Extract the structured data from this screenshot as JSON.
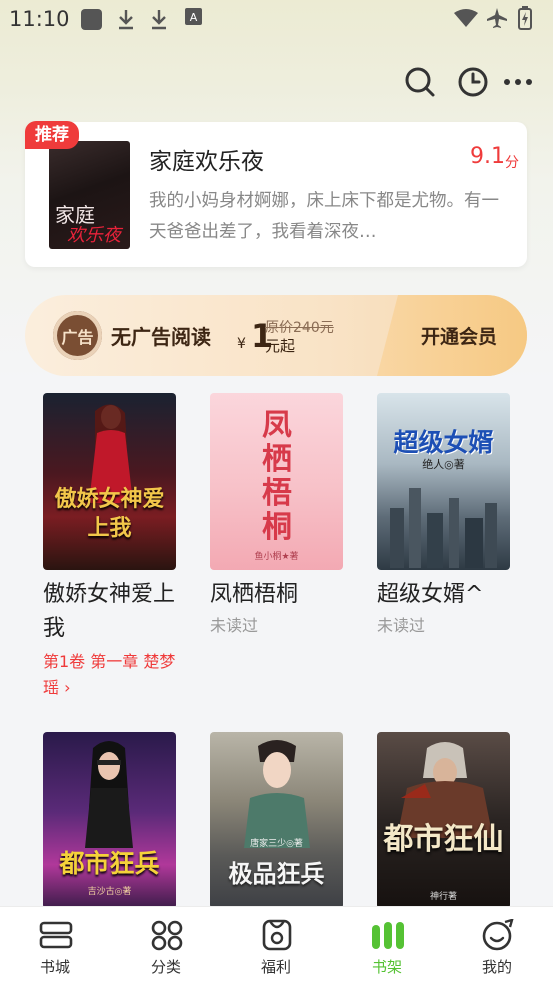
{
  "status_bar": {
    "time": "11:10"
  },
  "recommend": {
    "badge": "推荐",
    "cover_line1": "家庭",
    "cover_line2": "欢乐夜",
    "title": "家庭欢乐夜",
    "score": "9.1",
    "score_unit": "分",
    "description": "我的小妈身材婀娜，床上床下都是尤物。有一天爸爸出差了，我看着深夜…"
  },
  "vip_banner": {
    "icon_text": "广告",
    "label": "无广告阅读",
    "currency": "¥",
    "price": "1",
    "original_price": "原价240元",
    "price_suffix": "元起",
    "button": "开通会员"
  },
  "books": [
    {
      "title": "傲娇女神爱上我",
      "cover_title": "傲娇女神爱上我",
      "progress": "第1卷 第一章 楚梦瑶 ›"
    },
    {
      "title": "凤栖梧桐",
      "cover_title": "凤栖梧桐",
      "cover_author": "鱼小桐★著",
      "status": "未读过"
    },
    {
      "title": "超级女婿^",
      "cover_title": "超级女婿",
      "cover_author": "绝人◎著",
      "status": "未读过"
    },
    {
      "cover_title": "都市狂兵",
      "cover_author": "吉沙古◎著"
    },
    {
      "cover_title": "极品狂兵",
      "cover_author": "唐家三少◎著"
    },
    {
      "cover_title": "都市狂仙",
      "cover_author": "神行著"
    }
  ],
  "tabs": [
    {
      "label": "书城",
      "icon": "bookstore-icon"
    },
    {
      "label": "分类",
      "icon": "category-icon"
    },
    {
      "label": "福利",
      "icon": "welfare-icon"
    },
    {
      "label": "书架",
      "icon": "bookshelf-icon",
      "active": true
    },
    {
      "label": "我的",
      "icon": "profile-icon"
    }
  ],
  "colors": {
    "accent_red": "#ef3b3b",
    "active_green": "#55c234",
    "vip_brown": "#3d2614"
  }
}
